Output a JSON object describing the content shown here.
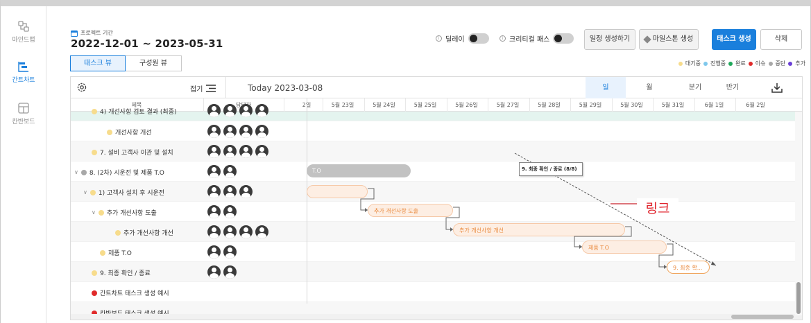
{
  "nav": [
    {
      "label": "마인드맵",
      "icon": "mindmap-icon",
      "active": false
    },
    {
      "label": "간트차트",
      "icon": "gantt-icon",
      "active": true
    },
    {
      "label": "칸반보드",
      "icon": "kanban-icon",
      "active": false
    }
  ],
  "header": {
    "project_label": "프로젝트 기간",
    "project_dates": "2022-12-01 ~ 2023-05-31",
    "view_tabs": [
      {
        "label": "태스크 뷰",
        "active": true
      },
      {
        "label": "구성원 뷰",
        "active": false
      }
    ],
    "delay_label": "딜레이",
    "critical_label": "크리티컬 패스",
    "btn_schedule": "일정 생성하기",
    "btn_milestone": "마일스톤 생성",
    "btn_task": "태스크 생성",
    "btn_delete": "삭제",
    "legend": [
      {
        "label": "대기중",
        "color": "#f7dc8c"
      },
      {
        "label": "진행중",
        "color": "#7fc8ec"
      },
      {
        "label": "완료",
        "color": "#1fa85a"
      },
      {
        "label": "이슈",
        "color": "#e02b2b"
      },
      {
        "label": "중단",
        "color": "#a8a8a8"
      },
      {
        "label": "추가",
        "color": "#6a3fd6"
      }
    ]
  },
  "gantt": {
    "fold_label": "접기",
    "today_label": "Today",
    "today_date": "2023-03-08",
    "scales": [
      {
        "label": "일",
        "active": true
      },
      {
        "label": "월",
        "active": false
      },
      {
        "label": "분기",
        "active": false
      },
      {
        "label": "반기",
        "active": false
      }
    ],
    "col_title": "제목",
    "col_assignee": "담당자",
    "days": [
      "2일",
      "5월 23일",
      "5월 24일",
      "5월 25일",
      "5월 26일",
      "5월 27일",
      "5월 28일",
      "5월 29일",
      "5월 30일",
      "5월 31일",
      "6월 1일",
      "6월 2일"
    ],
    "rows": [
      {
        "title": "4) 개선사항 검토 결과 (최종)",
        "avatars": 4
      },
      {
        "title": "개선사항 개선",
        "avatars": 4
      },
      {
        "title": "7. 설비 고객사 이관 및 설치",
        "avatars": 4
      },
      {
        "title": "8. (2차) 시운전 및 제품 T.O",
        "avatars": 2
      },
      {
        "title": "1) 고객사 설치 후 시운전",
        "avatars": 3
      },
      {
        "title": "추가 개선사항 도출",
        "avatars": 2
      },
      {
        "title": "추가 개선사항 개선",
        "avatars": 4
      },
      {
        "title": "제품 T.O",
        "avatars": 2
      },
      {
        "title": "9. 최종 확인 / 종료",
        "avatars": 2
      },
      {
        "title": "간트차트 태스크 생성 예시",
        "avatars": 0
      },
      {
        "title": "칸반보드 태스크 생성 예시",
        "avatars": 0
      }
    ],
    "bars": {
      "to_bar": "T.O",
      "extra_find": "추가 개선사항 도출",
      "extra_fix": "추가 개선사항 개선",
      "product_to": "제품 T.O",
      "final": "9. 최종 확..."
    },
    "tooltip": "9. 최종 확인 / 종료 (8/8)",
    "annotation": "링크"
  }
}
